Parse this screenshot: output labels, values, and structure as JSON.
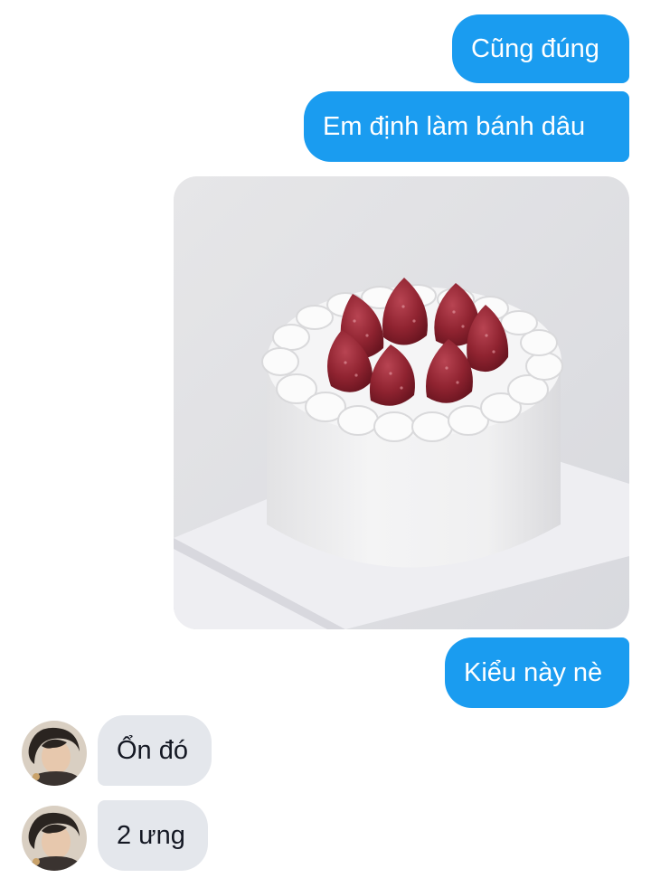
{
  "messages": [
    {
      "id": "m1",
      "direction": "outgoing",
      "text": "Cũng đúng"
    },
    {
      "id": "m2",
      "direction": "outgoing",
      "text": "Em định làm bánh dâu"
    },
    {
      "id": "m3",
      "direction": "outgoing",
      "type": "photo",
      "subject": "white cream cake topped with strawberries"
    },
    {
      "id": "m4",
      "direction": "outgoing",
      "text": "Kiểu này nè"
    },
    {
      "id": "m5",
      "direction": "incoming",
      "text": "Ổn đó"
    },
    {
      "id": "m6",
      "direction": "incoming",
      "text": "2 ưng"
    }
  ],
  "colors": {
    "outgoing_bubble": "#1a9cf0",
    "incoming_bubble": "#e4e7ec",
    "outgoing_text": "#ffffff",
    "incoming_text": "#141823"
  },
  "icons": {
    "contact_avatar": "avatar-portrait"
  }
}
